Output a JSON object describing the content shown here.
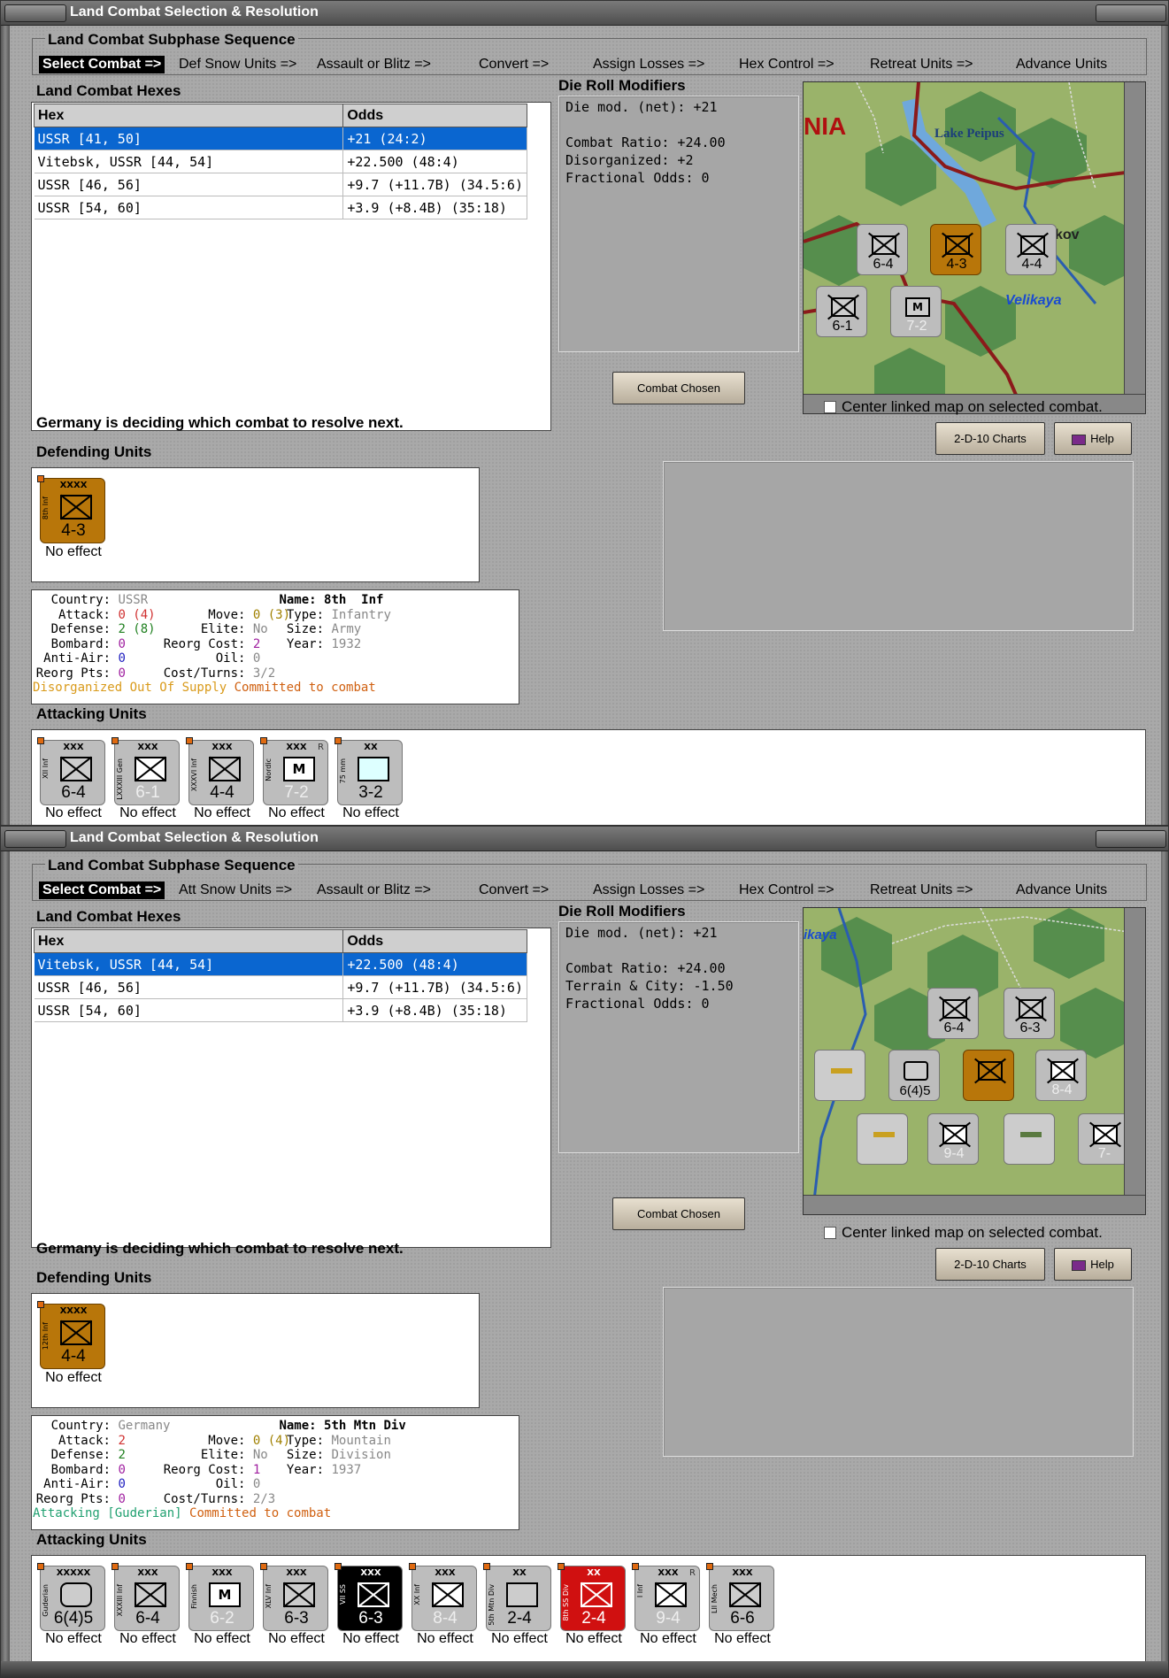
{
  "windows": [
    {
      "title": "Land Combat Selection & Resolution",
      "subphase_heading": "Land Combat Subphase Sequence",
      "sequence": [
        "Select Combat =>",
        "Def Snow Units =>",
        "Assault or Blitz =>",
        "Convert =>",
        "Assign Losses =>",
        "Hex Control =>",
        "Retreat Units =>",
        "Advance Units"
      ],
      "hexes_heading": "Land Combat Hexes",
      "table_headers": {
        "hex": "Hex",
        "odds": "Odds"
      },
      "hex_rows": [
        {
          "hex": "USSR [41, 50]",
          "odds": "+21 (24:2)"
        },
        {
          "hex": "Vitebsk, USSR [44, 54]",
          "odds": "+22.500 (48:4)"
        },
        {
          "hex": "USSR [46, 56]",
          "odds": "+9.7 (+11.7B) (34.5:6)"
        },
        {
          "hex": "USSR [54, 60]",
          "odds": "+3.9 (+8.4B) (35:18)"
        }
      ],
      "die_heading": "Die Roll Modifiers",
      "die_mods": [
        "Die mod. (net): +21",
        "",
        "Combat Ratio: +24.00",
        "Disorganized: +2",
        "Fractional Odds: 0"
      ],
      "combat_chosen": "Combat Chosen",
      "center_linked": "Center linked map on selected combat.",
      "status": "Germany is deciding which combat to resolve next.",
      "charts_btn": "2-D-10 Charts",
      "help_btn": "Help",
      "defending_heading": "Defending Units",
      "defenders": [
        {
          "name": "8th Inf",
          "size": "XXXX",
          "values": "4-3",
          "effect": "No effect"
        }
      ],
      "info": {
        "country_label": "Country:",
        "country": "USSR",
        "name_label": "Name:",
        "name": "8th  Inf",
        "attack_label": "Attack:",
        "attack": "0 (4)",
        "move_label": "Move:",
        "move": "0 (3)",
        "type_label": "Type:",
        "type": "Infantry",
        "defense_label": "Defense:",
        "defense": "2 (8)",
        "elite_label": "Elite:",
        "elite": "No",
        "unitsize_label": "Size:",
        "unitsize": "Army",
        "bombard_label": "Bombard:",
        "bombard": "0",
        "reorg_cost_label": "Reorg Cost:",
        "reorg_cost": "2",
        "year_label": "Year:",
        "year": "1932",
        "antiair_label": "Anti-Air:",
        "antiair": "0",
        "oil_label": "Oil:",
        "oil": "0",
        "reorg_pts_label": "Reorg Pts:",
        "reorg_pts": "0",
        "costturns_label": "Cost/Turns:",
        "costturns": "3/2",
        "status1": "Disorganized Out Of Supply",
        "status2": "Committed to combat"
      },
      "attacking_heading": "Attacking Units",
      "attackers": [
        {
          "name": "XII Inf",
          "size": "XXX",
          "values": "6-4",
          "effect": "No effect",
          "style": "gray"
        },
        {
          "name": "LXXXIII Gen",
          "size": "XXX",
          "values": "6-1",
          "effect": "No effect",
          "style": "gray"
        },
        {
          "name": "XXXVI Inf",
          "size": "XXX",
          "values": "4-4",
          "effect": "No effect",
          "style": "gray"
        },
        {
          "name": "Nordic",
          "size": "XXX",
          "values": "7-2",
          "effect": "No effect",
          "style": "gray-m",
          "letter": "M",
          "r": "R"
        },
        {
          "name": "75 mm",
          "size": "XX",
          "values": "3-2",
          "effect": "No effect",
          "style": "gray-art"
        }
      ],
      "map_labels": [
        "NIA",
        "Lake Peipus",
        "Velikaya",
        "kov"
      ],
      "map_counters": [
        {
          "values": "6-4"
        },
        {
          "values": "4-3"
        },
        {
          "values": "4-4"
        },
        {
          "values": "6-1"
        },
        {
          "values": "7-2"
        }
      ]
    },
    {
      "title": "Land Combat Selection & Resolution",
      "subphase_heading": "Land Combat Subphase Sequence",
      "sequence": [
        "Select Combat =>",
        "Att Snow Units =>",
        "Assault or Blitz =>",
        "Convert =>",
        "Assign Losses =>",
        "Hex Control =>",
        "Retreat Units =>",
        "Advance Units"
      ],
      "hexes_heading": "Land Combat Hexes",
      "table_headers": {
        "hex": "Hex",
        "odds": "Odds"
      },
      "hex_rows": [
        {
          "hex": "Vitebsk, USSR [44, 54]",
          "odds": "+22.500 (48:4)"
        },
        {
          "hex": "USSR [46, 56]",
          "odds": "+9.7 (+11.7B) (34.5:6)"
        },
        {
          "hex": "USSR [54, 60]",
          "odds": "+3.9 (+8.4B) (35:18)"
        }
      ],
      "die_heading": "Die Roll Modifiers",
      "die_mods": [
        "Die mod. (net): +21",
        "",
        "Combat Ratio: +24.00",
        "Terrain & City: -1.50",
        "Fractional Odds: 0"
      ],
      "combat_chosen": "Combat Chosen",
      "center_linked": "Center linked map on selected combat.",
      "status": "Germany is deciding which combat to resolve next.",
      "charts_btn": "2-D-10 Charts",
      "help_btn": "Help",
      "defending_heading": "Defending Units",
      "defenders": [
        {
          "name": "12th Inf",
          "size": "XXXX",
          "values": "4-4",
          "effect": "No effect"
        }
      ],
      "info": {
        "country_label": "Country:",
        "country": "Germany",
        "name_label": "Name:",
        "name": "5th Mtn Div",
        "attack_label": "Attack:",
        "attack": "2",
        "move_label": "Move:",
        "move": "0 (4)",
        "type_label": "Type:",
        "type": "Mountain",
        "defense_label": "Defense:",
        "defense": "2",
        "elite_label": "Elite:",
        "elite": "No",
        "unitsize_label": "Size:",
        "unitsize": "Division",
        "bombard_label": "Bombard:",
        "bombard": "0",
        "reorg_cost_label": "Reorg Cost:",
        "reorg_cost": "1",
        "year_label": "Year:",
        "year": "1937",
        "antiair_label": "Anti-Air:",
        "antiair": "0",
        "oil_label": "Oil:",
        "oil": "0",
        "reorg_pts_label": "Reorg Pts:",
        "reorg_pts": "0",
        "costturns_label": "Cost/Turns:",
        "costturns": "2/3",
        "status1": "Attacking [Guderian]",
        "status2": "Committed to combat"
      },
      "attacking_heading": "Attacking Units",
      "attackers": [
        {
          "name": "Guderian",
          "size": "XXXXX",
          "values": "6(4)5",
          "effect": "No effect",
          "style": "gray-hq"
        },
        {
          "name": "XXXIII Inf",
          "size": "XXX",
          "values": "6-4",
          "effect": "No effect",
          "style": "gray"
        },
        {
          "name": "Finnish",
          "size": "XXX",
          "values": "6-2",
          "effect": "No effect",
          "style": "gray-m",
          "letter": "M"
        },
        {
          "name": "XLV Inf",
          "size": "XXX",
          "values": "6-3",
          "effect": "No effect",
          "style": "gray"
        },
        {
          "name": "VII SS",
          "size": "XXX",
          "values": "6-3",
          "effect": "No effect",
          "style": "black"
        },
        {
          "name": "XX Inf",
          "size": "XXX",
          "values": "8-4",
          "effect": "No effect",
          "style": "gray-dim"
        },
        {
          "name": "5th Mtn Div",
          "size": "XX",
          "values": "2-4",
          "effect": "No effect",
          "style": "gray-mtn"
        },
        {
          "name": "8th SS Div",
          "size": "XX",
          "values": "2-4",
          "effect": "No effect",
          "style": "red"
        },
        {
          "name": "I Inf",
          "size": "XXX",
          "values": "9-4",
          "effect": "No effect",
          "style": "gray-dim",
          "r": "R"
        },
        {
          "name": "LII Mech",
          "size": "XXX",
          "values": "6-6",
          "effect": "No effect",
          "style": "gray"
        }
      ],
      "map_labels": [
        "ikaya"
      ],
      "map_counters": [
        {
          "values": "6-4"
        },
        {
          "values": "6-3"
        },
        {
          "values": "6(4)5"
        },
        {
          "values": "8-4"
        },
        {
          "values": "9-4"
        },
        {
          "values": "7-"
        }
      ]
    }
  ],
  "colors": {
    "selection": "#0a66d0",
    "disorganized": "#d99a1a",
    "committed": "#d06010",
    "attacking": "#20a070",
    "red": "#d03030",
    "green": "#208020",
    "purple": "#a020a0",
    "blue": "#2020c0"
  }
}
